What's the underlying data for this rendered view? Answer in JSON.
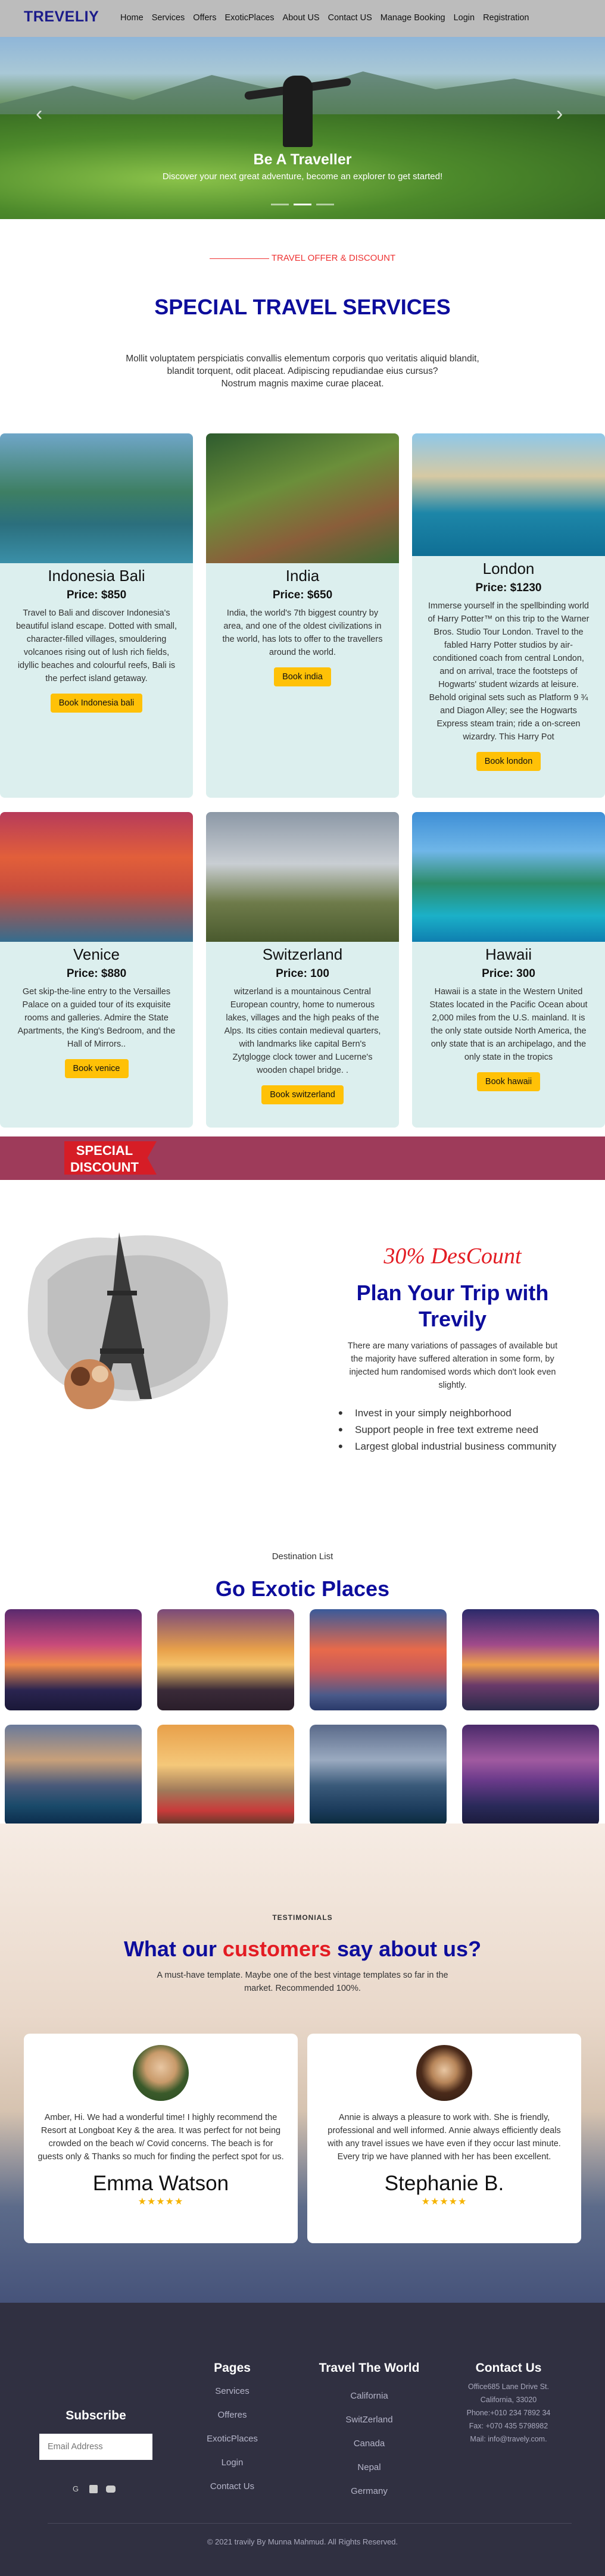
{
  "nav": {
    "brand": "TREVELIY",
    "links": [
      "Home",
      "Services",
      "Offers",
      "ExoticPlaces",
      "About US",
      "Contact US",
      "Manage Booking",
      "Login",
      "Registration"
    ]
  },
  "hero": {
    "title": "Be A Traveller",
    "subtitle": "Discover your next great adventure, become an explorer to get started!",
    "prev_icon": "chevron-left-icon",
    "next_icon": "chevron-right-icon"
  },
  "services": {
    "eyebrow": "TRAVEL OFFER & DISCOUNT",
    "title": "SPECIAL TRAVEL SERVICES",
    "intro_lines": [
      "Mollit voluptatem perspiciatis convallis elementum corporis quo veritatis aliquid blandit,",
      "blandit torquent, odit placeat. Adipiscing repudiandae eius cursus?",
      "Nostrum magnis maxime curae placeat."
    ],
    "cards": [
      {
        "name": "Indonesia Bali",
        "price": "Price: $850",
        "text": "Travel to Bali and discover Indonesia's beautiful island escape. Dotted with small, character-filled villages, smouldering volcanoes rising out of lush rich fields, idyllic beaches and colourful reefs, Bali is the perfect island getaway.",
        "button": "Book Indonesia bali"
      },
      {
        "name": "India",
        "price": "Price: $650",
        "text": "India, the world's 7th biggest country by area, and one of the oldest civilizations in the world, has lots to offer to the travellers around the world.",
        "button": "Book india"
      },
      {
        "name": "London",
        "price": "Price: $1230",
        "text": "Immerse yourself in the spellbinding world of Harry Potter™ on this trip to the Warner Bros. Studio Tour London. Travel to the fabled Harry Potter studios by air-conditioned coach from central London, and on arrival, trace the footsteps of Hogwarts' student wizards at leisure. Behold original sets such as Platform 9 ¾ and Diagon Alley; see the Hogwarts Express steam train; ride a on-screen wizardry. This Harry Pot",
        "button": "Book london"
      },
      {
        "name": "Venice",
        "price": "Price: $880",
        "text": "Get skip-the-line entry to the Versailles Palace on a guided tour of its exquisite rooms and galleries. Admire the State Apartments, the King's Bedroom, and the Hall of Mirrors..",
        "button": "Book venice"
      },
      {
        "name": "Switzerland",
        "price": "Price: 100",
        "text": "witzerland is a mountainous Central European country, home to numerous lakes, villages and the high peaks of the Alps. Its cities contain medieval quarters, with landmarks like capital Bern's Zytglogge clock tower and Lucerne's wooden chapel bridge. .",
        "button": "Book switzerland"
      },
      {
        "name": "Hawaii",
        "price": "Price: 300",
        "text": "Hawaii is a state in the Western United States located in the Pacific Ocean about 2,000 miles from the U.S. mainland. It is the only state outside North America, the only state that is an archipelago, and the only state in the tropics",
        "button": "Book hawaii"
      }
    ]
  },
  "banner": {
    "line1": "SPECIAL",
    "line2": "DISCOUNT"
  },
  "offer": {
    "percent": "30% DesCount",
    "title": "Plan Your Trip with Trevily",
    "text": "There are many variations of passages of available but the majority have suffered alteration in some form, by injected hum randomised words which don't look even slightly.",
    "bullets": [
      "Invest in your simply neighborhood",
      "Support people in free text extreme need",
      "Largest global industrial business community"
    ]
  },
  "destinations": {
    "label": "Destination List",
    "title": "Go Exotic Places"
  },
  "testimonials": {
    "tag": "TESTIMONIALS",
    "title_pre": "What our ",
    "title_mid": "customers",
    "title_post": " say about us?",
    "subtitle": "A must-have template. Maybe one of the best vintage templates so far in the market. Recommended 100%.",
    "items": [
      {
        "text": "Amber, Hi. We had a wonderful time! I highly recommend the Resort at Longboat Key & the area. It was perfect for not being crowded on the beach w/ Covid concerns. The beach is for guests only & Thanks so much for finding the perfect spot for us.",
        "name": "Emma Watson",
        "stars": "★★★★★"
      },
      {
        "text": "Annie is always a pleasure to work with. She is friendly, professional and well informed. Annie always efficiently deals with any travel issues we have even if they occur last minute. Every trip we have planned with her has been excellent.",
        "name": "Stephanie B.",
        "stars": "★★★★★"
      }
    ]
  },
  "footer": {
    "subscribe_title": "Subscribe",
    "email_placeholder": "Email Address",
    "pages_title": "Pages",
    "pages": [
      "Services",
      "Offeres",
      "ExoticPlaces",
      "Login",
      "Contact Us"
    ],
    "world_title": "Travel The World",
    "world": [
      "California",
      "SwitZerland",
      "Canada",
      "Nepal",
      "Germany"
    ],
    "contact_title": "Contact Us",
    "contact": [
      "Office685 Lane Drive St.",
      "California, 33020",
      "Phone:+010 234 7892 34",
      "Fax: +070 435 5798982",
      "Mail: info@travely.com."
    ],
    "copyright": "© 2021 travily By Munna Mahmud. All Rights Reserved."
  }
}
